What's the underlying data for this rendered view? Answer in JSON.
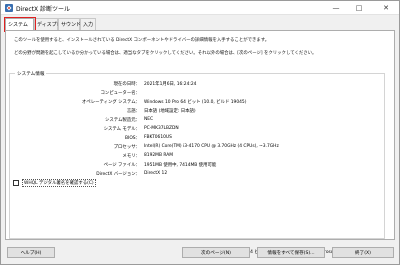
{
  "window": {
    "title": "DirectX 診断ツール"
  },
  "tabs": [
    {
      "label": "システム"
    },
    {
      "label": "ディスプレイ"
    },
    {
      "label": "サウンド"
    },
    {
      "label": "入力"
    }
  ],
  "intro": {
    "line1": "このツールを使用すると、インストールされている DirectX コンポーネントやドライバーの詳細情報を入手することができます。",
    "line2": "どの分野が問題を起こしているか分かっている場合は、適当なタブをクリックしてください。それ以外の場合は、[次のページ] をクリックしてください。"
  },
  "system_info": {
    "legend": "システム情報",
    "rows": [
      {
        "label": "現在の日時：",
        "value": "2021年1月6日, 16:24:24"
      },
      {
        "label": "コンピューター名：",
        "value": ""
      },
      {
        "label": "オペレーティング システム：",
        "value": "Windows 10 Pro 64 ビット (10.0, ビルド 19045)"
      },
      {
        "label": "言語：",
        "value": "日本語 (地域設定: 日本語)"
      },
      {
        "label": "システム製造元：",
        "value": "NEC"
      },
      {
        "label": "システム モデル：",
        "value": "PC-MK37LBZDN"
      },
      {
        "label": "BIOS：",
        "value": "FBKT0610US"
      },
      {
        "label": "プロセッサ：",
        "value": "Intel(R) Core(TM) i3-4170 CPU @ 3.70GHz (4 CPUs), ~3.7GHz"
      },
      {
        "label": "メモリ：",
        "value": "8192MB RAM"
      },
      {
        "label": "ページ ファイル：",
        "value": "1951MB 使用中, 7414MB 使用可能"
      },
      {
        "label": "DirectX バージョン：",
        "value": "DirectX 12"
      }
    ]
  },
  "checkbox": {
    "label": "WHQL デジタル署名を確認する(C)",
    "checked": false
  },
  "status_line": "DxDiag 10.00.19041.0928 64 ビット Unicode  Copyright © Microsoft. All rights reserved.",
  "buttons": {
    "help": "ヘルプ(H)",
    "next": "次のページ(N)",
    "save": "情報をすべて保存(S)...",
    "exit": "終了(X)"
  }
}
